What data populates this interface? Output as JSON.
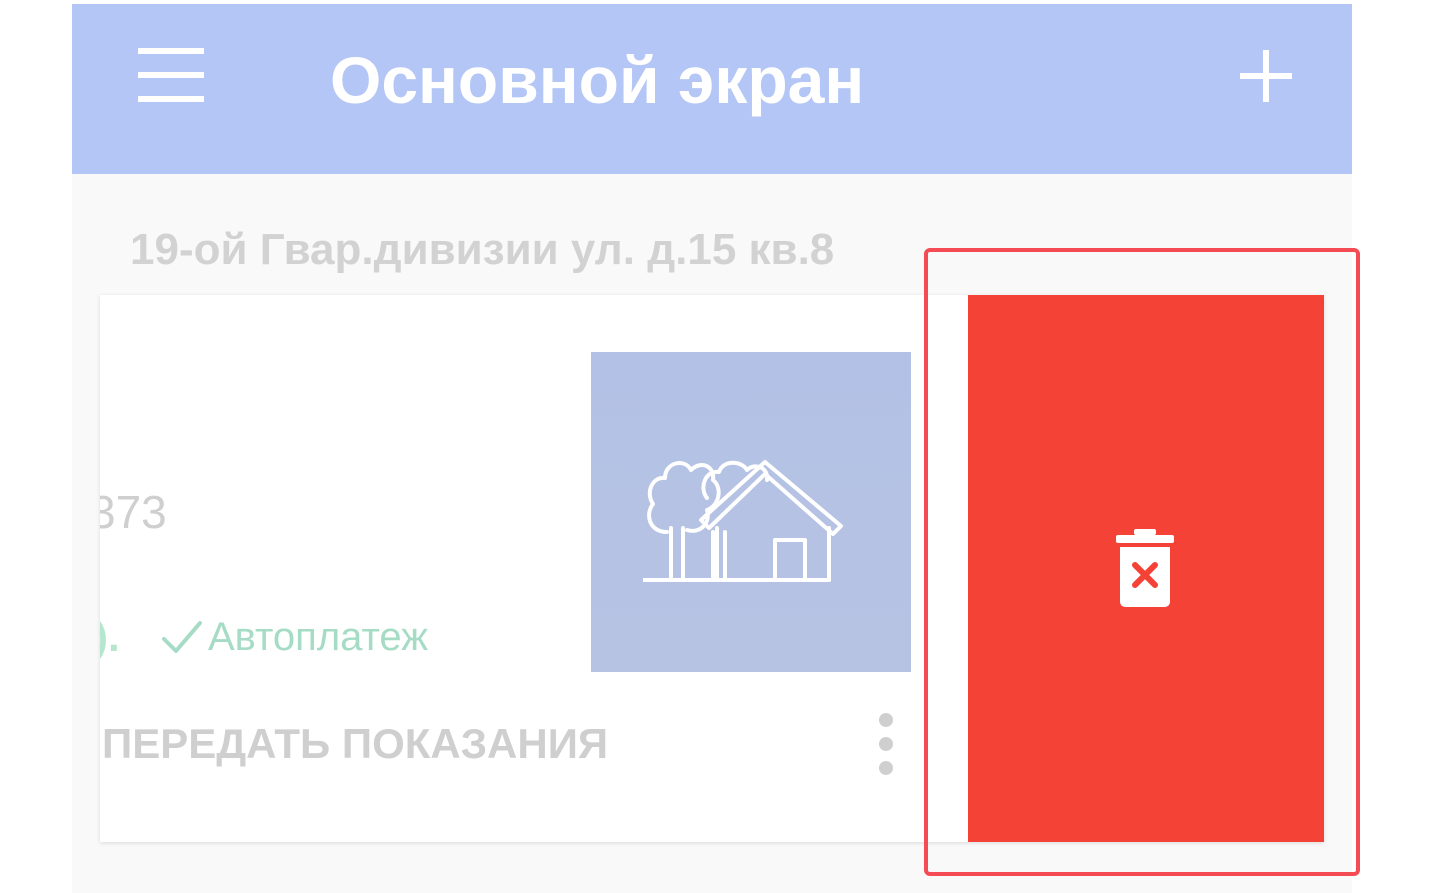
{
  "appbar": {
    "title": "Основной экран",
    "menu_icon": "hamburger-menu-icon",
    "add_icon": "plus-icon",
    "background": "#b4c6f6"
  },
  "address": "19-ой Гвар.дивизии ул. д.15 кв.8",
  "card": {
    "account_fragment": "373",
    "balance_fragment": ").",
    "autopay_label": "Автоплатеж",
    "send_readings_label": "ПЕРЕДАТЬ ПОКАЗАНИЯ",
    "property_icon": "house-with-trees-icon",
    "more_icon": "more-vertical-icon",
    "check_icon": "check-icon"
  },
  "delete_action": {
    "icon": "trash-delete-icon",
    "color": "#f44336"
  },
  "colors": {
    "accent": "#b4c6f6",
    "autopay_green": "#a6dcc5",
    "delete_red": "#f44336",
    "highlight_border": "#f44b55"
  }
}
